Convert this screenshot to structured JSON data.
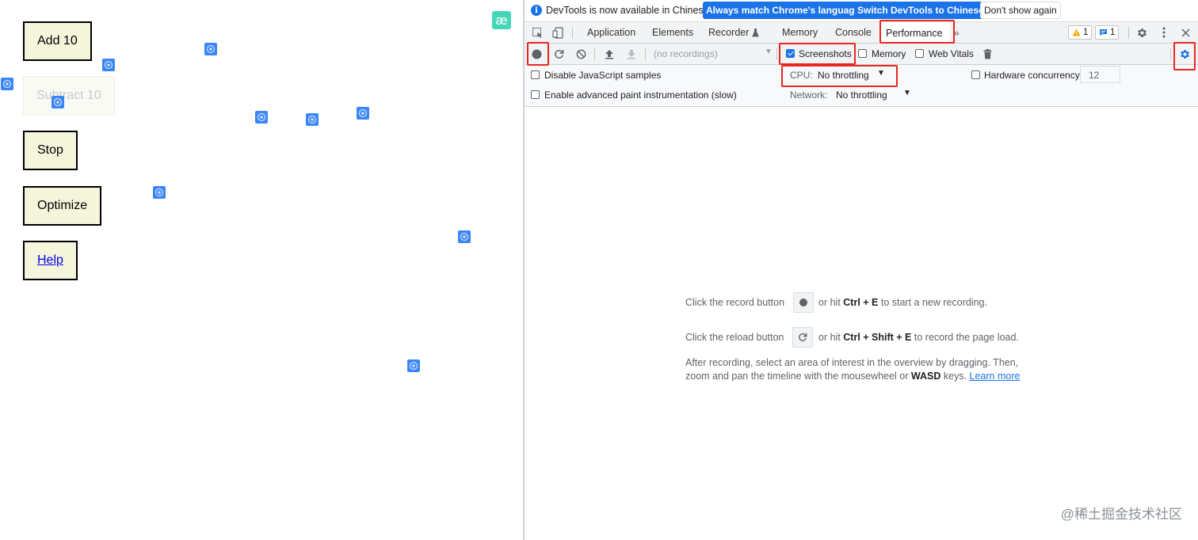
{
  "page": {
    "buttons": [
      {
        "label": "Add 10"
      },
      {
        "label": "Subtract 10"
      },
      {
        "label": "Stop"
      },
      {
        "label": "Optimize"
      },
      {
        "label": "Help"
      }
    ],
    "logo_text": "æ"
  },
  "infobar": {
    "text": "DevTools is now available in Chinese!",
    "match_label": "Always match Chrome's language",
    "switch_label": "Switch DevTools to Chinese",
    "dismiss_label": "Don't show again"
  },
  "tabs": [
    "Application",
    "Elements",
    "Recorder",
    "Memory",
    "Console",
    "Performance"
  ],
  "active_tab": "Performance",
  "badges": {
    "warnings": "1",
    "messages": "1"
  },
  "toolbar": {
    "recordings_placeholder": "(no recordings)",
    "screenshots_label": "Screenshots",
    "memory_label": "Memory",
    "web_vitals_label": "Web Vitals"
  },
  "settings": {
    "disable_js_label": "Disable JavaScript samples",
    "paint_label": "Enable advanced paint instrumentation (slow)",
    "cpu_label": "CPU:",
    "cpu_value": "No throttling",
    "network_label": "Network:",
    "network_value": "No throttling",
    "hw_label": "Hardware concurrency",
    "hw_value": "12"
  },
  "empty_state": {
    "line1_pre": "Click the record button",
    "line1_post_a": "or hit ",
    "line1_key": "Ctrl + E",
    "line1_post_b": " to start a new recording.",
    "line2_pre": "Click the reload button",
    "line2_post_a": "or hit ",
    "line2_key": "Ctrl + Shift + E",
    "line2_post_b": " to record the page load.",
    "line3": "After recording, select an area of interest in the overview by dragging. Then,",
    "line4_a": "zoom and pan the timeline with the mousewheel or ",
    "line4_key": "WASD",
    "line4_b": " keys. ",
    "learn_more": "Learn more"
  },
  "watermark": "@稀土掘金技术社区",
  "colors": {
    "accent": "#1a73e8",
    "highlight": "#e8281f",
    "square": "#3b86f6",
    "button_bg": "#f5f5dc"
  }
}
